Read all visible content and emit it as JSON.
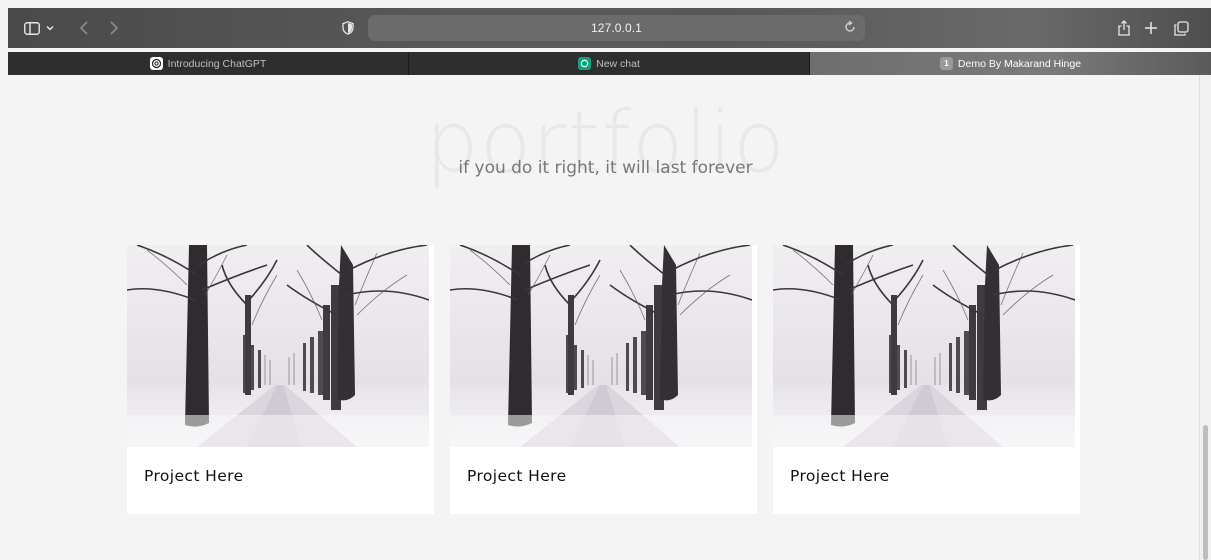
{
  "browser": {
    "url": "127.0.0.1",
    "tabs": [
      {
        "label": "Introducing ChatGPT",
        "favicon": "openai-icon",
        "active": false
      },
      {
        "label": "New chat",
        "favicon": "chatgpt-icon",
        "active": false
      },
      {
        "label": "Demo By Makarand Hinge",
        "favicon": "tab-number-icon",
        "badge": "1",
        "active": true
      }
    ]
  },
  "page": {
    "background_title": "portfolio",
    "subtitle": "if you do it right, it will last forever",
    "projects": [
      {
        "title": "Project Here",
        "image": "snowy-tree-lined-road"
      },
      {
        "title": "Project Here",
        "image": "snowy-tree-lined-road"
      },
      {
        "title": "Project Here",
        "image": "snowy-tree-lined-road"
      }
    ]
  },
  "colors": {
    "chrome": "#555555",
    "active_tab": "#747474",
    "page_background": "#f4f4f4",
    "card_background": "#ffffff"
  }
}
